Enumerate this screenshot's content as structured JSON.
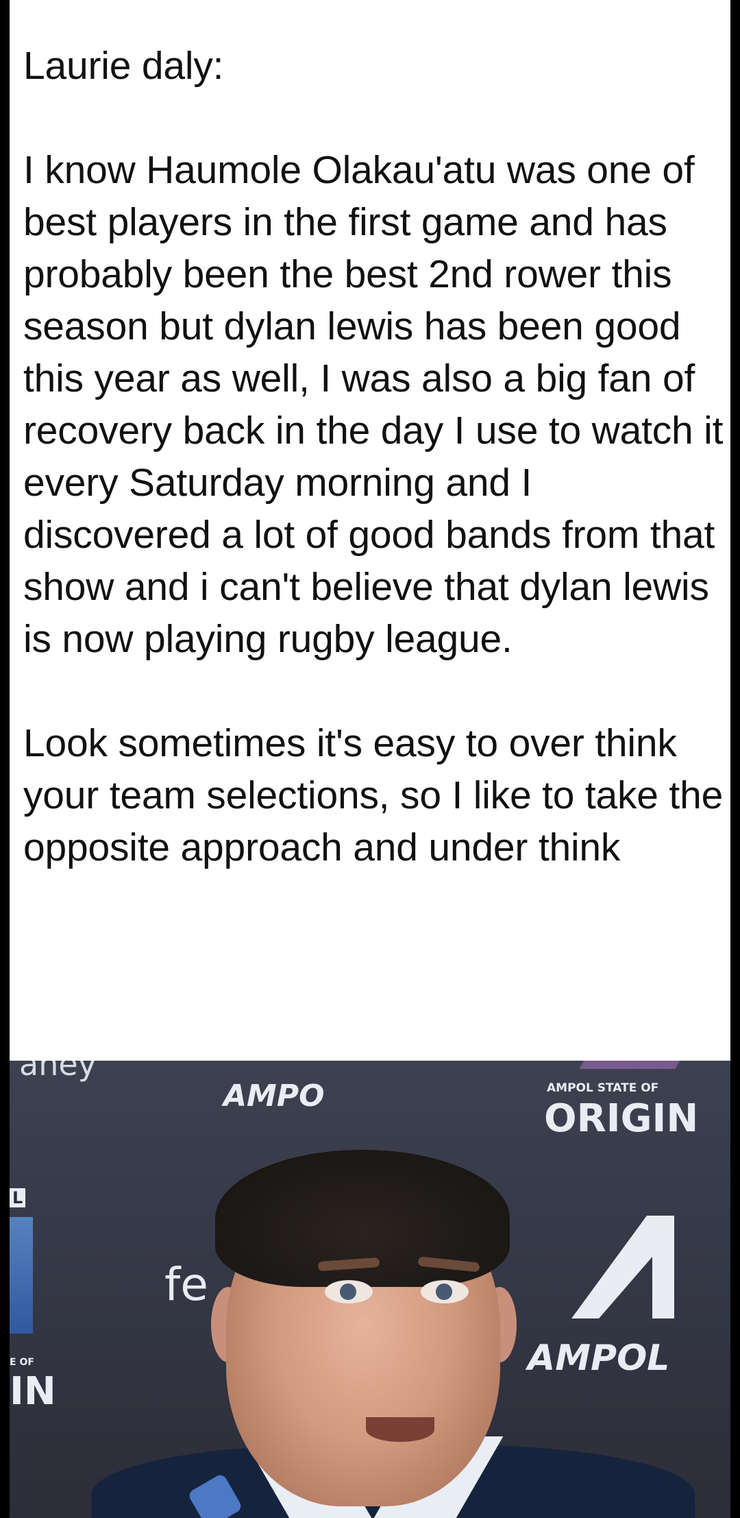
{
  "post": {
    "author_line": "Laurie daly:",
    "paragraph_1": "I know Haumole Olakau'atu was one of best players in the first game and has probably been the best 2nd rower this season but dylan lewis has been good this year as well, I was also a big fan of recovery back in the day I use to watch it every Saturday morning and I discovered a lot of good bands from that show and i can't believe that dylan lewis is now playing rugby league.",
    "paragraph_2": "Look sometimes it's easy to over think your team selections, so I like to take the opposite approach and under think"
  },
  "photo": {
    "backdrop_sydney": "aney",
    "backdrop_ampol_top": "AMPO",
    "backdrop_state_of": "AMPOL STATE OF",
    "backdrop_origin": "ORIGIN",
    "backdrop_fe": "fe",
    "backdrop_ampol": "AMPOL",
    "backdrop_eof": "E OF",
    "backdrop_in": "IN",
    "backdrop_l": "L"
  },
  "colors": {
    "page_bg": "#ffffff",
    "text": "#111111",
    "backdrop": "#353846",
    "frame_border": "#000000"
  }
}
